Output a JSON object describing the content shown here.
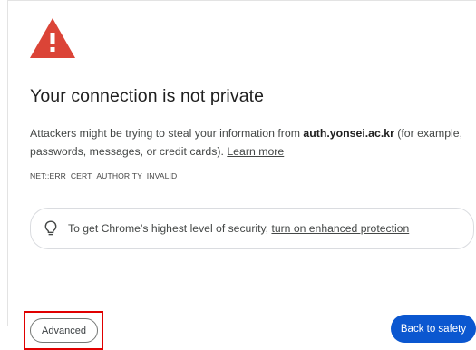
{
  "page": {
    "title": "Your connection is not private",
    "description": {
      "before_domain": "Attackers might be trying to steal your information from ",
      "domain": "auth.yonsei.ac.kr",
      "after_domain": " (for example, passwords, messages, or credit cards). ",
      "learn_more": "Learn more"
    },
    "error_code": "NET::ERR_CERT_AUTHORITY_INVALID"
  },
  "promo": {
    "icon": "lightbulb-icon",
    "text": "To get Chrome’s highest level of security, ",
    "link": "turn on enhanced protection"
  },
  "buttons": {
    "advanced": "Advanced",
    "back_to_safety": "Back to safety"
  },
  "colors": {
    "warning_red": "#db4437",
    "primary_blue": "#0b57d0",
    "highlight_box": "#e00000"
  }
}
